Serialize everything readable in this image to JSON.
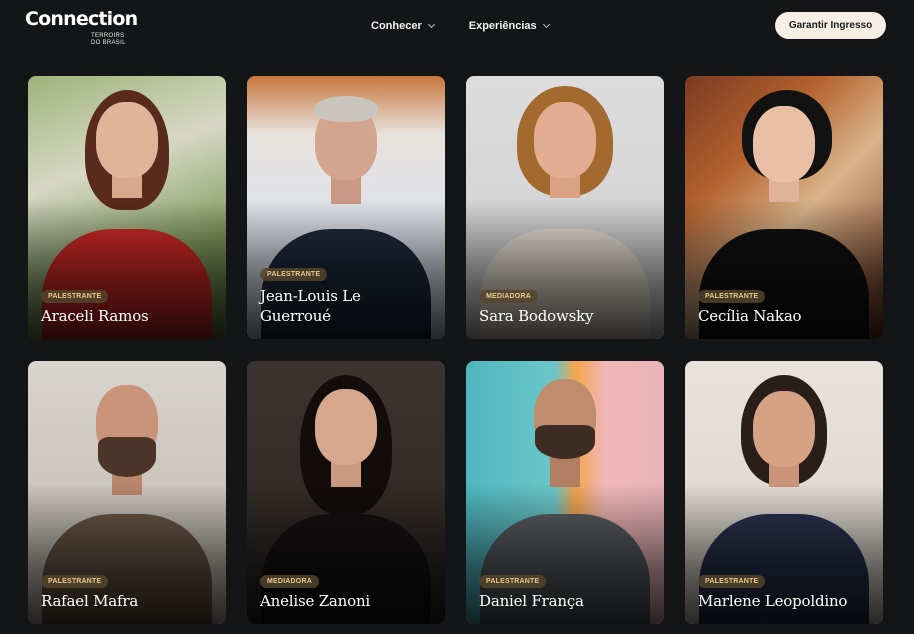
{
  "brand": {
    "name": "Connection",
    "sub_line1": "TERROIRS",
    "sub_line2": "DO BRASIL"
  },
  "nav": [
    {
      "label": "Conhecer"
    },
    {
      "label": "Experiências"
    }
  ],
  "cta_label": "Garantir Ingresso",
  "speakers": [
    {
      "name": "Araceli Ramos",
      "role": "PALESTRANTE"
    },
    {
      "name": "Jean-Louis Le Guerroué",
      "role": "PALESTRANTE"
    },
    {
      "name": "Sara Bodowsky",
      "role": "MEDIADORA"
    },
    {
      "name": "Cecília Nakao",
      "role": "PALESTRANTE"
    },
    {
      "name": "Rafael Mafra",
      "role": "PALESTRANTE"
    },
    {
      "name": "Anelise Zanoni",
      "role": "MEDIADORA"
    },
    {
      "name": "Daniel França",
      "role": "PALESTRANTE"
    },
    {
      "name": "Marlene Leopoldino",
      "role": "PALESTRANTE"
    }
  ],
  "colors": {
    "background": "#141516",
    "badge_text": "#e7c98a",
    "cta_bg": "#f7efe4"
  }
}
